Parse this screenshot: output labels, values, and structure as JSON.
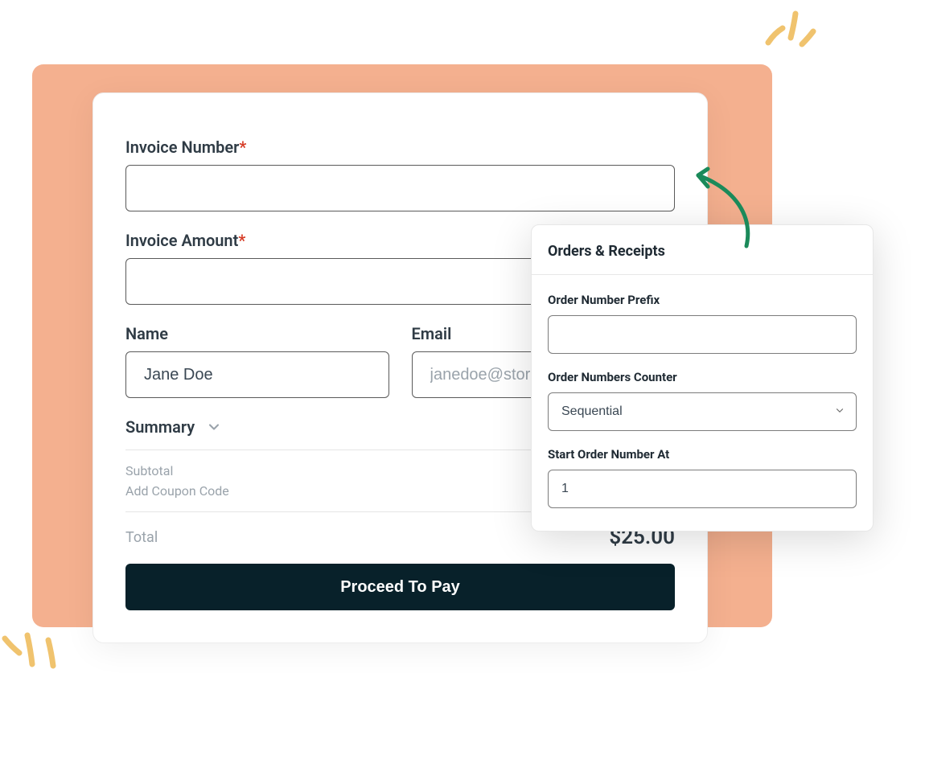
{
  "invoice_form": {
    "invoice_number_label": "Invoice Number",
    "invoice_number_value": "",
    "invoice_amount_label": "Invoice Amount",
    "invoice_amount_value": "",
    "required_mark": "*",
    "name_label": "Name",
    "name_value": "Jane Doe",
    "email_label": "Email",
    "email_placeholder": "janedoe@store",
    "summary_label": "Summary",
    "subtotal_label": "Subtotal",
    "coupon_label": "Add Coupon Code",
    "total_label": "Total",
    "total_value": "$25.00",
    "proceed_button": "Proceed To Pay"
  },
  "orders_panel": {
    "title": "Orders & Receipts",
    "prefix_label": "Order Number Prefix",
    "prefix_value": "",
    "counter_label": "Order Numbers Counter",
    "counter_value": "Sequential",
    "start_label": "Start Order Number At",
    "start_value": "1"
  },
  "colors": {
    "peach": "#f4b08f",
    "dark": "#08212a",
    "accent_green": "#1b8a5a"
  }
}
